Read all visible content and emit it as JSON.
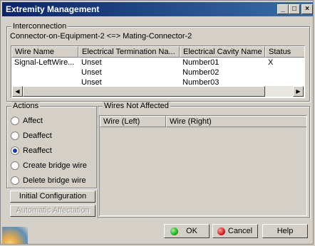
{
  "window": {
    "title": "Extremity Management"
  },
  "titlebar_buttons": [
    "_",
    "□",
    "×"
  ],
  "interconnection": {
    "group_label": "Interconnection",
    "connector_text": "Connector-on-Equipment-2 <=> Mating-Connector-2",
    "columns": [
      "Wire Name",
      "Electrical Termination Na...",
      "Electrical Cavity Name",
      "Status"
    ],
    "rows": [
      [
        "Signal-LeftWire...",
        "Unset",
        "Number01",
        "X"
      ],
      [
        "",
        "Unset",
        "Number02",
        ""
      ],
      [
        "",
        "Unset",
        "Number03",
        ""
      ]
    ]
  },
  "actions": {
    "group_label": "Actions",
    "options": [
      {
        "label": "Affect",
        "selected": false
      },
      {
        "label": "Deaffect",
        "selected": false
      },
      {
        "label": "Reaffect",
        "selected": true
      },
      {
        "label": "Create bridge wire",
        "selected": false
      },
      {
        "label": "Delete bridge wire",
        "selected": false
      }
    ],
    "initial_configuration_label": "Initial Configuration",
    "automatic_affectation_label": "Automatic Affectation"
  },
  "wires_not_affected": {
    "group_label": "Wires Not Affected",
    "columns": [
      "Wire (Left)",
      "Wire (Right)"
    ]
  },
  "footer": {
    "ok_label": "OK",
    "cancel_label": "Cancel",
    "help_label": "Help"
  },
  "colors": {
    "title_gradient_start": "#0a246a",
    "title_gradient_end": "#3a6ea5",
    "ok_icon": "#22b022",
    "cancel_icon": "#d42020",
    "radio_selected": "#1a3ca8"
  }
}
